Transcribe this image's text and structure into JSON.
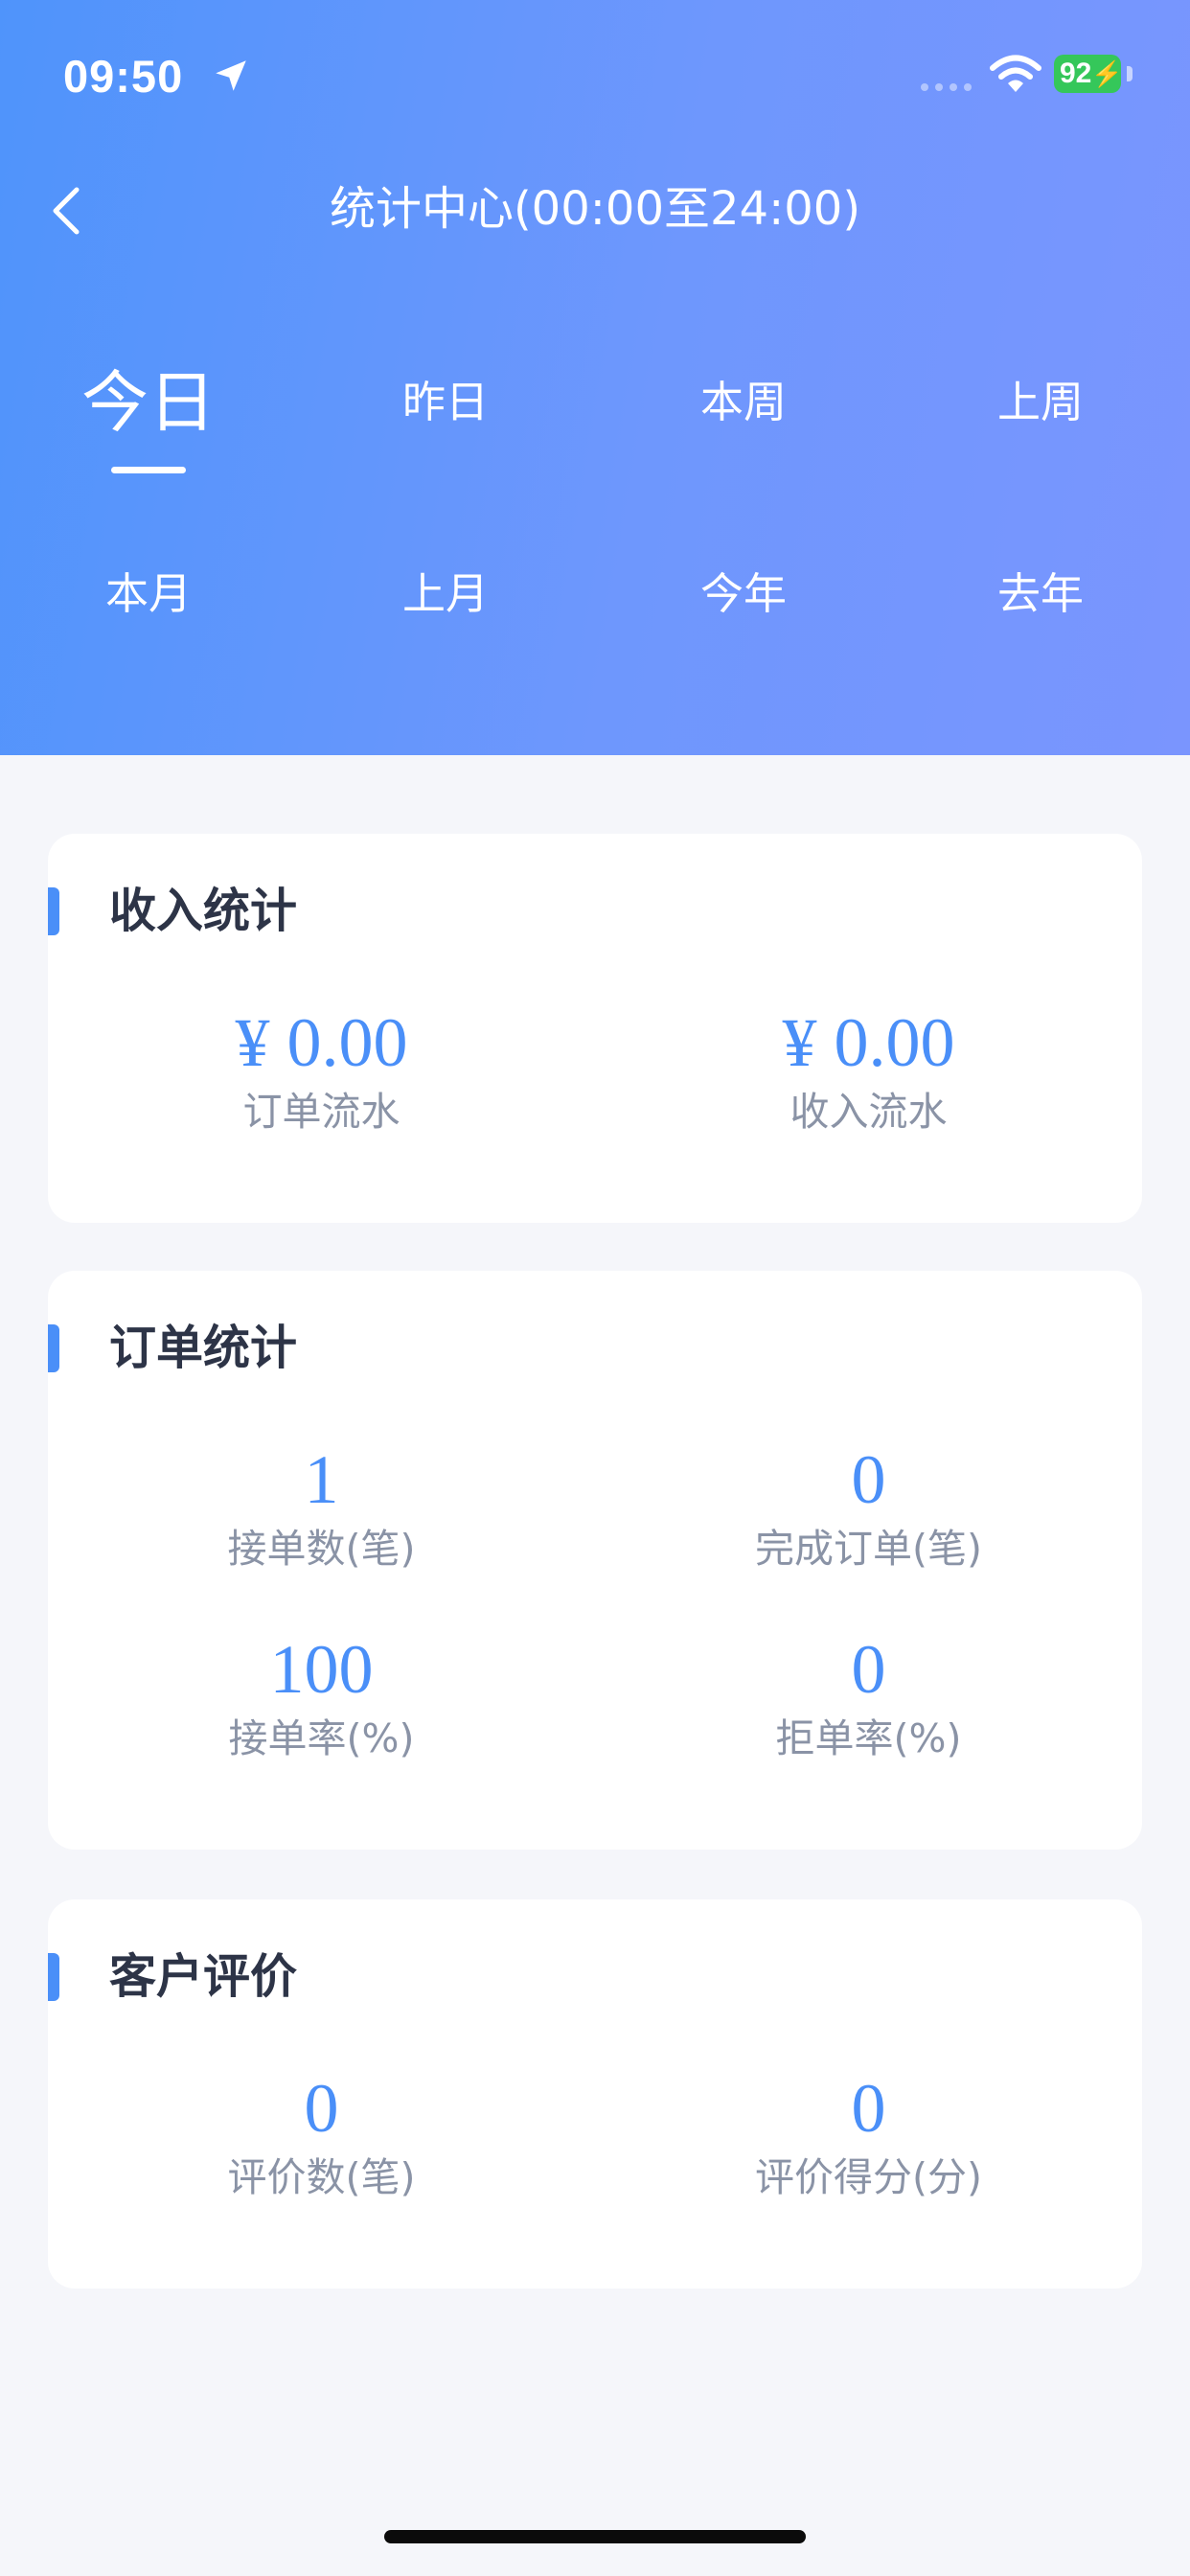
{
  "status_bar": {
    "time": "09:50",
    "battery": "92"
  },
  "nav": {
    "title": "统计中心(00:00至24:00)"
  },
  "tabs": [
    {
      "label": "今日",
      "active": true
    },
    {
      "label": "昨日",
      "active": false
    },
    {
      "label": "本周",
      "active": false
    },
    {
      "label": "上周",
      "active": false
    },
    {
      "label": "本月",
      "active": false
    },
    {
      "label": "上月",
      "active": false
    },
    {
      "label": "今年",
      "active": false
    },
    {
      "label": "去年",
      "active": false
    }
  ],
  "income": {
    "title": "收入统计",
    "order_flow": {
      "value": "¥ 0.00",
      "label": "订单流水"
    },
    "income_flow": {
      "value": "¥ 0.00",
      "label": "收入流水"
    }
  },
  "orders": {
    "title": "订单统计",
    "accepted": {
      "value": "1",
      "label": "接单数(笔)"
    },
    "completed": {
      "value": "0",
      "label": "完成订单(笔)"
    },
    "accept_rate": {
      "value": "100",
      "label": "接单率(%)"
    },
    "reject_rate": {
      "value": "0",
      "label": "拒单率(%)"
    }
  },
  "reviews": {
    "title": "客户评价",
    "count": {
      "value": "0",
      "label": "评价数(笔)"
    },
    "score": {
      "value": "0",
      "label": "评价得分(分)"
    }
  },
  "colors": {
    "accent": "#4a8ff8",
    "header_start": "#4f94fb",
    "header_end": "#7a95fe",
    "title_text": "#2d3447",
    "label_text": "#8a93a6",
    "battery_green": "#35c75a"
  }
}
